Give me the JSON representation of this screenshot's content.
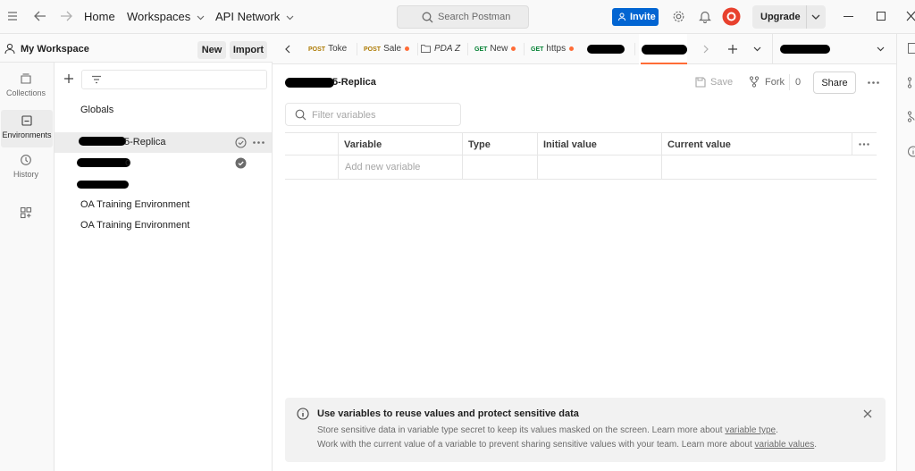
{
  "topbar": {
    "home": "Home",
    "workspaces": "Workspaces",
    "api_network": "API Network",
    "search_placeholder": "Search Postman",
    "invite": "Invite",
    "upgrade": "Upgrade",
    "colors": {
      "invite_bg": "#0265d2",
      "avatar": "#e8412e"
    }
  },
  "workspace": {
    "name": "My Workspace",
    "new_label": "New",
    "import_label": "Import"
  },
  "rail": {
    "items": [
      {
        "label": "Collections",
        "icon": "collections-icon"
      },
      {
        "label": "Environments",
        "icon": "environments-icon"
      },
      {
        "label": "History",
        "icon": "history-icon"
      },
      {
        "label": "",
        "icon": "configure-workspace-icon"
      }
    ]
  },
  "sidebar": {
    "globals": "Globals",
    "environments": [
      {
        "label": "5-Replica",
        "selected": true
      },
      {
        "label": "o",
        "selected": false
      },
      {
        "label": "",
        "selected": false
      },
      {
        "label": "OA Training Environment",
        "selected": false
      },
      {
        "label": "OA Training Environment",
        "selected": false
      }
    ]
  },
  "tabs": [
    {
      "method": "POST",
      "name": "Toke",
      "unsaved": false
    },
    {
      "method": "POST",
      "name": "Sale",
      "unsaved": true
    },
    {
      "method": "",
      "name": "PDA Z",
      "unsaved": false,
      "icon": "folder-icon"
    },
    {
      "method": "GET",
      "name": "New",
      "unsaved": true
    },
    {
      "method": "GET",
      "name": "https",
      "unsaved": false
    }
  ],
  "main": {
    "env_title": "5-Replica",
    "save": "Save",
    "fork": "Fork",
    "fork_count": "0",
    "share": "Share",
    "filter_placeholder": "Filter variables",
    "table": {
      "headers": [
        "Variable",
        "Type",
        "Initial value",
        "Current value"
      ],
      "new_row_placeholder": "Add new variable"
    }
  },
  "banner": {
    "title": "Use variables to reuse values and protect sensitive data",
    "line1": "Store sensitive data in variable type secret to keep its values masked on the screen. Learn more about",
    "line1_link": "variable type",
    "line2": "Work with the current value of a variable to prevent sharing sensitive values with your team. Learn more about",
    "line2_link": "variable values"
  }
}
